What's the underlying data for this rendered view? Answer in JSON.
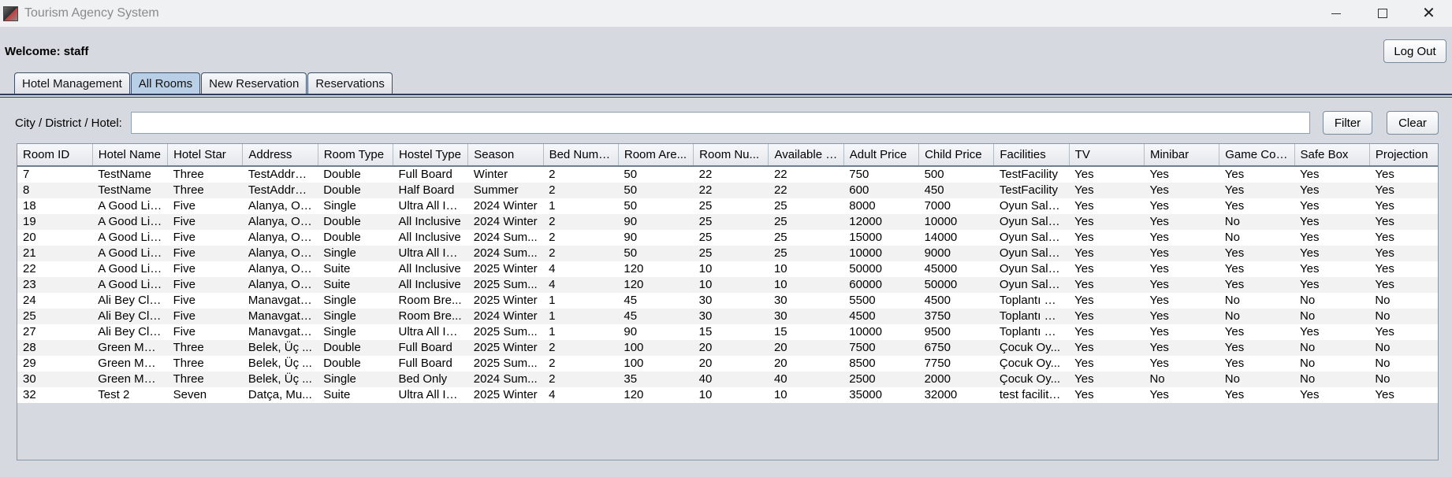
{
  "window": {
    "title": "Tourism Agency System"
  },
  "header": {
    "welcome": "Welcome: staff",
    "logout_label": "Log Out"
  },
  "tabs": [
    {
      "label": "Hotel Management",
      "active": false
    },
    {
      "label": "All Rooms",
      "active": true
    },
    {
      "label": "New Reservation",
      "active": false
    },
    {
      "label": "Reservations",
      "active": false
    }
  ],
  "filter": {
    "label": "City / District / Hotel:",
    "value": "",
    "filter_label": "Filter",
    "clear_label": "Clear"
  },
  "table": {
    "columns": [
      "Room ID",
      "Hotel Name",
      "Hotel Star",
      "Address",
      "Room Type",
      "Hostel Type",
      "Season",
      "Bed Number",
      "Room Are...",
      "Room Nu...",
      "Available R...",
      "Adult Price",
      "Child Price",
      "Facilities",
      "TV",
      "Minibar",
      "Game Con...",
      "Safe Box",
      "Projection"
    ],
    "rows": [
      [
        "7",
        "TestName",
        "Three",
        "TestAddress",
        "Double",
        "Full Board",
        "Winter",
        "2",
        "50",
        "22",
        "22",
        "750",
        "500",
        "TestFacility",
        "Yes",
        "Yes",
        "Yes",
        "Yes",
        "Yes"
      ],
      [
        "8",
        "TestName",
        "Three",
        "TestAddress",
        "Double",
        "Half Board",
        "Summer",
        "2",
        "50",
        "22",
        "22",
        "600",
        "450",
        "TestFacility",
        "Yes",
        "Yes",
        "Yes",
        "Yes",
        "Yes"
      ],
      [
        "18",
        "A Good Lif...",
        "Five",
        "Alanya, Ok...",
        "Single",
        "Ultra All Incl...",
        "2024 Winter",
        "1",
        "50",
        "25",
        "25",
        "8000",
        "7000",
        "Oyun Salo...",
        "Yes",
        "Yes",
        "Yes",
        "Yes",
        "Yes"
      ],
      [
        "19",
        "A Good Lif...",
        "Five",
        "Alanya, Ok...",
        "Double",
        "All Inclusive",
        "2024 Winter",
        "2",
        "90",
        "25",
        "25",
        "12000",
        "10000",
        "Oyun Salo...",
        "Yes",
        "Yes",
        "No",
        "Yes",
        "Yes"
      ],
      [
        "20",
        "A Good Lif...",
        "Five",
        "Alanya, Ok...",
        "Double",
        "All Inclusive",
        "2024 Sum...",
        "2",
        "90",
        "25",
        "25",
        "15000",
        "14000",
        "Oyun Salo...",
        "Yes",
        "Yes",
        "No",
        "Yes",
        "Yes"
      ],
      [
        "21",
        "A Good Lif...",
        "Five",
        "Alanya, Ok...",
        "Single",
        "Ultra All Incl...",
        "2024 Sum...",
        "2",
        "50",
        "25",
        "25",
        "10000",
        "9000",
        "Oyun Salo...",
        "Yes",
        "Yes",
        "Yes",
        "Yes",
        "Yes"
      ],
      [
        "22",
        "A Good Lif...",
        "Five",
        "Alanya, Ok...",
        "Suite",
        "All Inclusive",
        "2025 Winter",
        "4",
        "120",
        "10",
        "10",
        "50000",
        "45000",
        "Oyun Salo...",
        "Yes",
        "Yes",
        "Yes",
        "Yes",
        "Yes"
      ],
      [
        "23",
        "A Good Lif...",
        "Five",
        "Alanya, Ok...",
        "Suite",
        "All Inclusive",
        "2025 Sum...",
        "4",
        "120",
        "10",
        "10",
        "60000",
        "50000",
        "Oyun Salo...",
        "Yes",
        "Yes",
        "Yes",
        "Yes",
        "Yes"
      ],
      [
        "24",
        "Ali Bey Clu...",
        "Five",
        "Manavgat, ...",
        "Single",
        "Room Bre...",
        "2025 Winter",
        "1",
        "45",
        "30",
        "30",
        "5500",
        "4500",
        "Toplantı Sa...",
        "Yes",
        "Yes",
        "No",
        "No",
        "No"
      ],
      [
        "25",
        "Ali Bey Clu...",
        "Five",
        "Manavgat, ...",
        "Single",
        "Room Bre...",
        "2024 Winter",
        "1",
        "45",
        "30",
        "30",
        "4500",
        "3750",
        "Toplantı Sa...",
        "Yes",
        "Yes",
        "No",
        "No",
        "No"
      ],
      [
        "27",
        "Ali Bey Clu...",
        "Five",
        "Manavgat, ...",
        "Single",
        "Ultra All Incl...",
        "2025 Sum...",
        "1",
        "90",
        "15",
        "15",
        "10000",
        "9500",
        "Toplantı Sa...",
        "Yes",
        "Yes",
        "Yes",
        "Yes",
        "Yes"
      ],
      [
        "28",
        "Green Max...",
        "Three",
        "Belek, Üç ...",
        "Double",
        "Full Board",
        "2025 Winter",
        "2",
        "100",
        "20",
        "20",
        "7500",
        "6750",
        "Çocuk Oy...",
        "Yes",
        "Yes",
        "Yes",
        "No",
        "No"
      ],
      [
        "29",
        "Green Max...",
        "Three",
        "Belek, Üç ...",
        "Double",
        "Full Board",
        "2025 Sum...",
        "2",
        "100",
        "20",
        "20",
        "8500",
        "7750",
        "Çocuk Oy...",
        "Yes",
        "Yes",
        "Yes",
        "No",
        "No"
      ],
      [
        "30",
        "Green Max...",
        "Three",
        "Belek, Üç ...",
        "Single",
        "Bed Only",
        "2024 Sum...",
        "2",
        "35",
        "40",
        "40",
        "2500",
        "2000",
        "Çocuk Oy...",
        "Yes",
        "No",
        "No",
        "No",
        "No"
      ],
      [
        "32",
        "Test 2",
        "Seven",
        "Datça, Mu...",
        "Suite",
        "Ultra All Incl...",
        "2025 Winter",
        "4",
        "120",
        "10",
        "10",
        "35000",
        "32000",
        "test facility...",
        "Yes",
        "Yes",
        "Yes",
        "Yes",
        "Yes"
      ]
    ]
  },
  "icons": {
    "app": "app-icon",
    "minimize": "minimize-icon",
    "maximize": "maximize-icon",
    "close": "close-icon"
  },
  "colors": {
    "background": "#d6d9df",
    "active_tab": "#b8cfe6",
    "tab_border": "#3d5168",
    "row_alt": "#f2f2f2"
  }
}
